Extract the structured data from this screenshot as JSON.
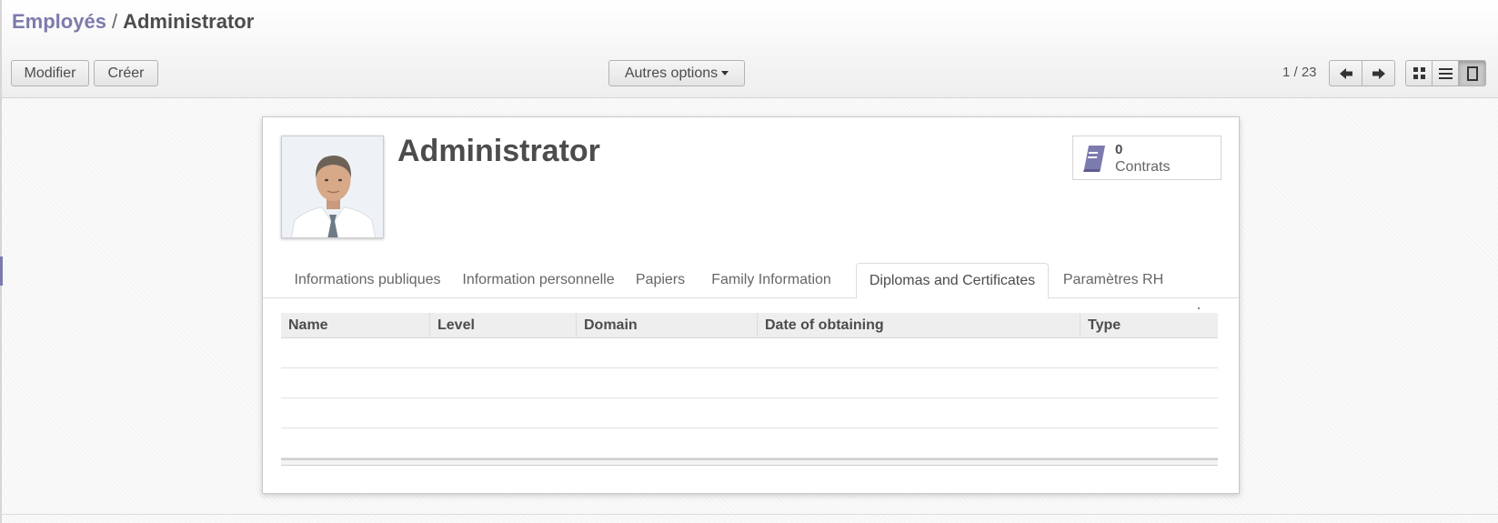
{
  "breadcrumb": {
    "parent": "Employés",
    "separator": "/",
    "current": "Administrator"
  },
  "toolbar": {
    "edit_label": "Modifier",
    "create_label": "Créer",
    "more_options_label": "Autres options"
  },
  "pager": {
    "value": "1 / 23",
    "prev_icon": "arrow-left-icon",
    "next_icon": "arrow-right-icon"
  },
  "view_switcher": [
    "kanban-view-icon",
    "list-view-icon",
    "form-view-icon"
  ],
  "employee": {
    "name": "Administrator",
    "avatar": "employee-photo"
  },
  "stat_button": {
    "value": "0",
    "label": "Contrats",
    "icon": "book-icon"
  },
  "tabs": [
    {
      "label": "Informations publiques",
      "active": false
    },
    {
      "label": "Information personnelle",
      "active": false
    },
    {
      "label": "Papiers",
      "active": false
    },
    {
      "label": "Family Information",
      "active": false
    },
    {
      "label": "Diplomas and Certificates",
      "active": true
    },
    {
      "label": "Paramètres RH",
      "active": false
    }
  ],
  "table": {
    "columns": [
      "Name",
      "Level",
      "Domain",
      "Date of obtaining",
      "Type"
    ],
    "rows": []
  },
  "colors": {
    "accent": "#7c7bad",
    "text": "#4c4c4c",
    "active_view": "#c8c8c8"
  }
}
